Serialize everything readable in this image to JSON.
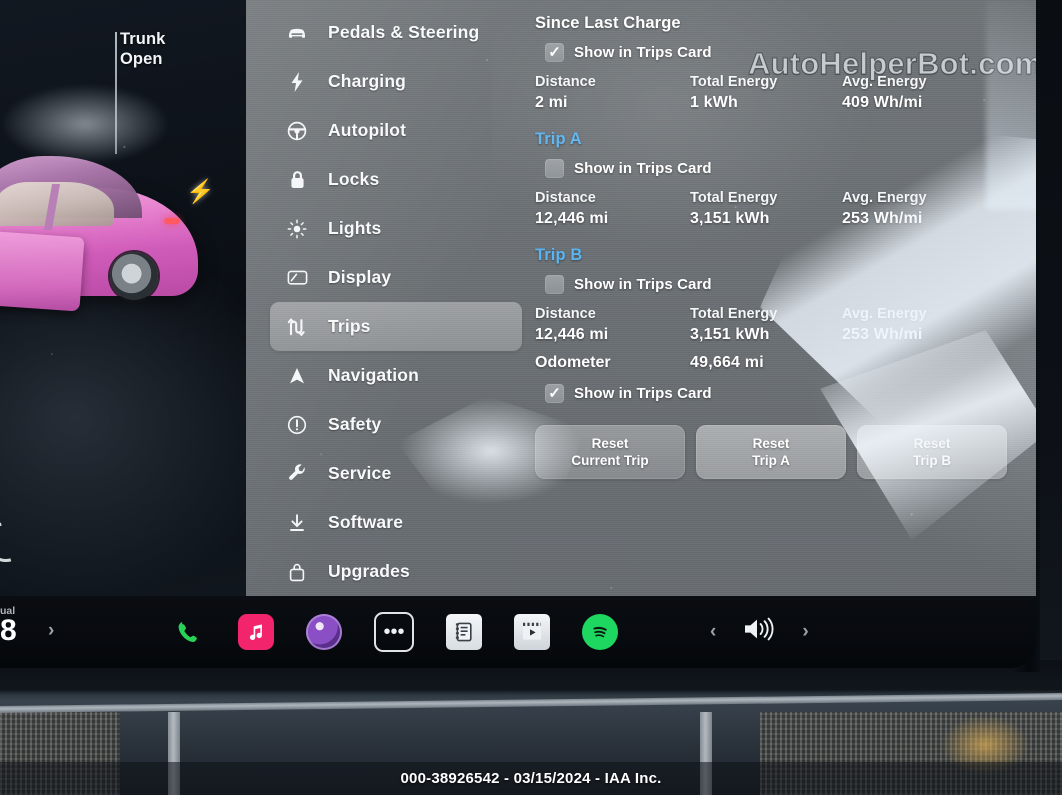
{
  "car_panel": {
    "alert_line1": "Trunk",
    "alert_line2": "Open",
    "charge_bolt_icon": "charge-bolt-icon"
  },
  "sidebar": {
    "items": [
      {
        "label": "Pedals & Steering",
        "icon": "car-icon",
        "active": false
      },
      {
        "label": "Charging",
        "icon": "bolt-icon",
        "active": false
      },
      {
        "label": "Autopilot",
        "icon": "steering-wheel-icon",
        "active": false
      },
      {
        "label": "Locks",
        "icon": "lock-icon",
        "active": false
      },
      {
        "label": "Lights",
        "icon": "brightness-icon",
        "active": false
      },
      {
        "label": "Display",
        "icon": "display-icon",
        "active": false
      },
      {
        "label": "Trips",
        "icon": "trips-road-icon",
        "active": true
      },
      {
        "label": "Navigation",
        "icon": "navigation-arrow-icon",
        "active": false
      },
      {
        "label": "Safety",
        "icon": "warning-circle-icon",
        "active": false
      },
      {
        "label": "Service",
        "icon": "wrench-icon",
        "active": false
      },
      {
        "label": "Software",
        "icon": "download-icon",
        "active": false
      },
      {
        "label": "Upgrades",
        "icon": "shopping-bag-icon",
        "active": false
      }
    ]
  },
  "trips": {
    "columns": [
      "Distance",
      "Total Energy",
      "Avg. Energy"
    ],
    "show_in_trips_card_label": "Show in Trips Card",
    "sections": [
      {
        "title": "Since Last Charge",
        "title_is_link": false,
        "checked": true,
        "distance": "2 mi",
        "total_energy": "1 kWh",
        "avg_energy": "409 Wh/mi"
      },
      {
        "title": "Trip A",
        "title_is_link": true,
        "checked": false,
        "distance": "12,446 mi",
        "total_energy": "3,151 kWh",
        "avg_energy": "253 Wh/mi"
      },
      {
        "title": "Trip B",
        "title_is_link": true,
        "checked": false,
        "distance": "12,446 mi",
        "total_energy": "3,151 kWh",
        "avg_energy": "253 Wh/mi"
      }
    ],
    "odometer": {
      "label": "Odometer",
      "value": "49,664 mi",
      "checked": true,
      "show_in_trips_card_label": "Show in Trips Card"
    },
    "buttons": [
      {
        "line1": "Reset",
        "line2": "Current Trip",
        "highlight": false
      },
      {
        "line1": "Reset",
        "line2": "Trip A",
        "highlight": true
      },
      {
        "line1": "Reset",
        "line2": "Trip B",
        "highlight": true
      }
    ]
  },
  "watermark": {
    "text": "AutoHelperBot.com"
  },
  "taskbar": {
    "climate_mode": "ual",
    "temperature": "8",
    "expand_chevron": "›",
    "apps": [
      {
        "name": "phone-app-icon",
        "glyph": "✆"
      },
      {
        "name": "music-app-icon",
        "glyph": "♫"
      },
      {
        "name": "camera-app-icon",
        "glyph": ""
      },
      {
        "name": "more-apps-icon",
        "glyph": "•••"
      },
      {
        "name": "calendar-app-icon",
        "glyph": "☷"
      },
      {
        "name": "video-app-icon",
        "glyph": "▶"
      },
      {
        "name": "spotify-app-icon",
        "glyph": "≋"
      }
    ],
    "volume": {
      "prev_glyph": "‹",
      "icon": "volume-icon",
      "next_glyph": "›"
    }
  },
  "caption": {
    "text": "000-38926542 - 03/15/2024 - IAA Inc."
  },
  "colors": {
    "screen_bg": "#6f7478",
    "link_blue": "#5ab4f0",
    "accent_white": "#ffffff",
    "car_pink": "#e883cf",
    "spotify_green": "#1ed760",
    "phone_green": "#28d256",
    "music_pink": "#f1246c"
  }
}
